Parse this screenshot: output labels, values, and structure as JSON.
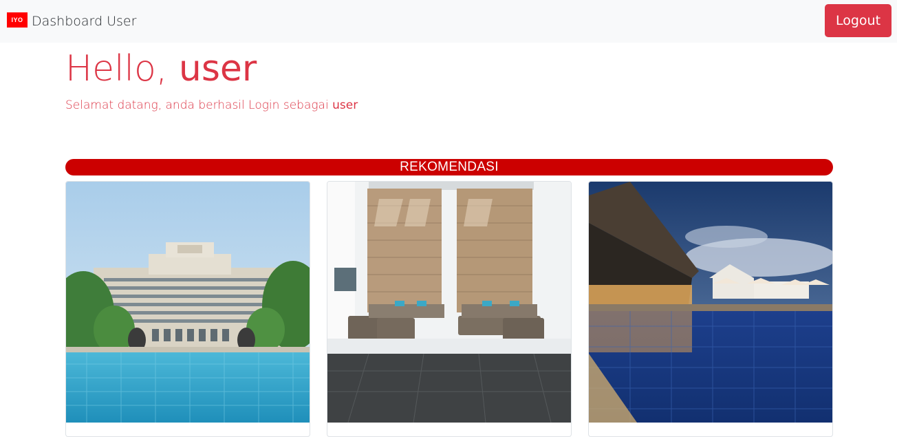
{
  "navbar": {
    "logo_text": "IYO",
    "brand": "Dashboard User",
    "logout_label": "Logout"
  },
  "greeting": {
    "hello": "Hello, ",
    "username": "user",
    "welcome": "Selamat datang, anda berhasil Login sebagai ",
    "role": "user"
  },
  "section": {
    "title": "REKOMENDASI"
  },
  "cards": [
    {
      "image": "hotel-pool-photo"
    },
    {
      "image": "stone-lobby-photo"
    },
    {
      "image": "resort-night-pool-photo"
    }
  ],
  "colors": {
    "accent": "#dc3545",
    "section_bar": "#cc0000",
    "logo": "#ff0000",
    "navbar_bg": "#f8f9fa"
  }
}
